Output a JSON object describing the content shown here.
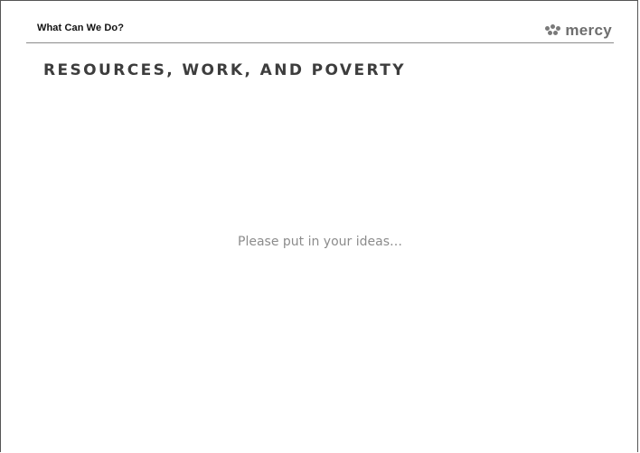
{
  "header": {
    "section_label": "What Can We Do?",
    "logo_text": "mercy"
  },
  "slide": {
    "title": "RESOURCES, WORK, AND POVERTY",
    "body_text": "Please put in your ideas…"
  },
  "colors": {
    "title": "#3d3d3d",
    "body_text": "#8c8c8c",
    "logo": "#6e6e6e",
    "rule": "#8a8a8a"
  },
  "icons": {
    "logo_mark": "mercy-logo-icon"
  }
}
